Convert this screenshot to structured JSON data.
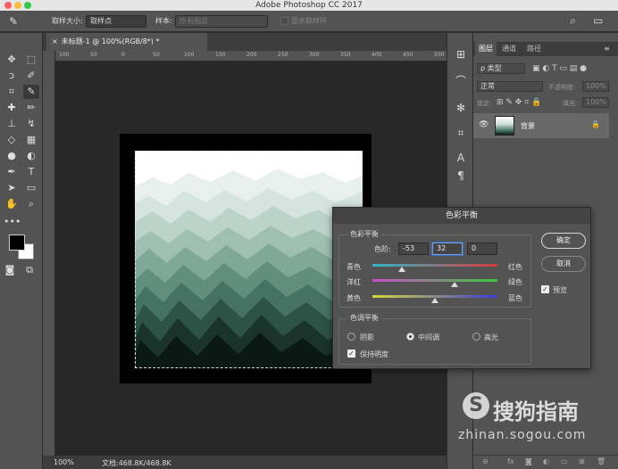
{
  "window": {
    "title": "Adobe Photoshop CC 2017"
  },
  "options_bar": {
    "tool_icon": "eyedropper-icon",
    "sample_size_label": "取样大小:",
    "sample_size_value": "取样点",
    "sample_label": "样本:",
    "sample_value": "所有图层",
    "show_ring_label": "显示取样环",
    "search_icon": "search-icon",
    "workspace_icon": "workspace-icon"
  },
  "document": {
    "tab_title": "未标题-1 @ 100%(RGB/8*) *",
    "ruler_ticks": [
      "100",
      "50",
      "0",
      "50",
      "100",
      "150",
      "200",
      "250",
      "300",
      "350",
      "400",
      "450",
      "500"
    ]
  },
  "status_bar": {
    "zoom": "100%",
    "doc_info": "文档:468.8K/468.8K"
  },
  "layers_panel": {
    "tabs": [
      "图层",
      "通道",
      "路径"
    ],
    "kind_filter": "ρ 类型",
    "blend_mode": "正常",
    "opacity_label": "不透明度:",
    "opacity_value": "100%",
    "lock_label": "锁定:",
    "fill_label": "填充:",
    "fill_value": "100%",
    "layers": [
      {
        "name": "背景",
        "visible": true,
        "locked": true
      }
    ]
  },
  "color_balance_dialog": {
    "title": "色彩平衡",
    "section_balance": "色彩平衡",
    "levels_label": "色阶:",
    "levels": [
      "-53",
      "32",
      "0"
    ],
    "sliders": [
      {
        "left": "青色",
        "right": "红色",
        "value": -53
      },
      {
        "left": "洋红",
        "right": "绿色",
        "value": 32
      },
      {
        "left": "黄色",
        "right": "蓝色",
        "value": 0
      }
    ],
    "section_tone": "色调平衡",
    "tones": [
      "阴影",
      "中间调",
      "高光"
    ],
    "selected_tone": "中间调",
    "preserve_luminosity": "保持明度",
    "preserve_checked": true,
    "ok_label": "确定",
    "cancel_label": "取消",
    "preview_label": "预览",
    "preview_checked": true
  },
  "watermark": {
    "brand": "搜狗指南",
    "url": "zhinan.sogou.com",
    "logo_letter": "S"
  },
  "colors": {
    "foreground": "#000000",
    "background": "#ffffff",
    "cyan_red_gradient": [
      "#2fb6c8",
      "#d63c3c"
    ],
    "magenta_green_gradient": [
      "#c84fc8",
      "#3cc83c"
    ],
    "yellow_blue_gradient": [
      "#d8d83c",
      "#3c3cd8"
    ]
  }
}
